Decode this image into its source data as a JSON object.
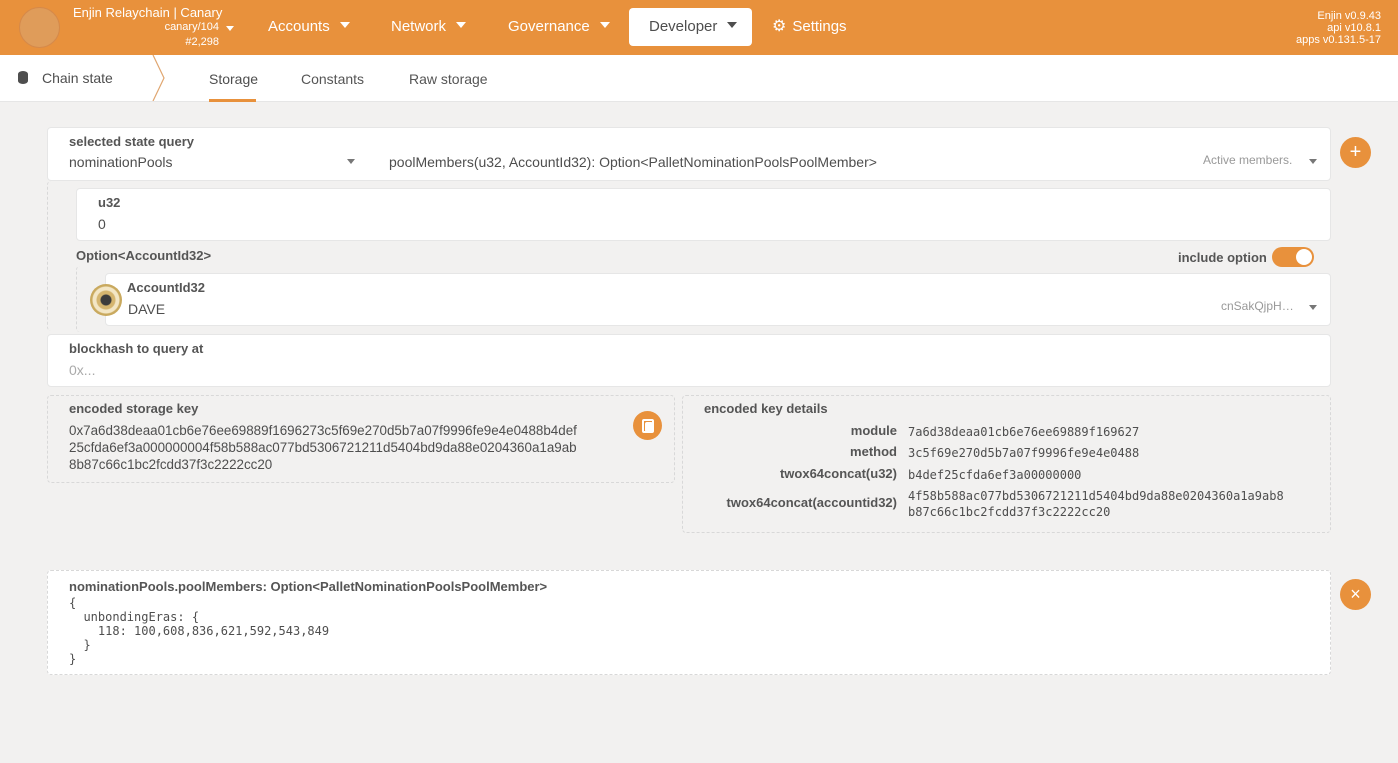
{
  "header": {
    "chain_name": "Enjin Relaychain | Canary",
    "chain_runtime": "canary/104",
    "chain_block": "#2,298",
    "nav": {
      "accounts": "Accounts",
      "network": "Network",
      "governance": "Governance",
      "developer": "Developer",
      "settings": "Settings"
    },
    "versions": {
      "node": "Enjin v0.9.43",
      "api": "api v10.8.1",
      "apps": "apps v0.131.5-17"
    },
    "brand_color": "#e8913c"
  },
  "subnav": {
    "title": "Chain state",
    "tabs": [
      "Storage",
      "Constants",
      "Raw storage"
    ],
    "active_tab": "Storage"
  },
  "query": {
    "label": "selected state query",
    "module": "nominationPools",
    "method": "poolMembers(u32, AccountId32): Option<PalletNominationPoolsPoolMember>",
    "method_hint": "Active members."
  },
  "params": {
    "u32_label": "u32",
    "u32_value": "0",
    "option_label": "Option<AccountId32>",
    "include_option_label": "include option",
    "include_option": true,
    "account_label": "AccountId32",
    "account_name": "DAVE",
    "account_address": "cnSakQjpH…"
  },
  "blockhash": {
    "label": "blockhash to query at",
    "placeholder": "0x..."
  },
  "encoded_key": {
    "label": "encoded storage key",
    "line1": "0x7a6d38deaa01cb6e76ee69889f1696273c5f69e270d5b7a07f9996fe9e4e0488b4def",
    "line2": "25cfda6ef3a000000004f58b588ac077bd5306721211d5404bd9da88e0204360a1a9ab",
    "line3": "8b87c66c1bc2fcdd37f3c2222cc20"
  },
  "key_details": {
    "label": "encoded key details",
    "module_label": "module",
    "module_value": "7a6d38deaa01cb6e76ee69889f169627",
    "method_label": "method",
    "method_value": "3c5f69e270d5b7a07f9996fe9e4e0488",
    "twox_u32_label": "twox64concat(u32)",
    "twox_u32_value": "b4def25cfda6ef3a00000000",
    "twox_account_label": "twox64concat(accountid32)",
    "twox_account_line1": "4f58b588ac077bd5306721211d5404bd9da88e0204360a1a9ab8",
    "twox_account_line2": "b87c66c1bc2fcdd37f3c2222cc20"
  },
  "result": {
    "label": "nominationPools.poolMembers: Option<PalletNominationPoolsPoolMember>",
    "lines": [
      "{",
      "  unbondingEras: {",
      "    118: 100,608,836,621,592,543,849",
      "  }",
      "}"
    ]
  },
  "icons": {
    "add": "+",
    "close": "×",
    "settings": "⚙"
  }
}
